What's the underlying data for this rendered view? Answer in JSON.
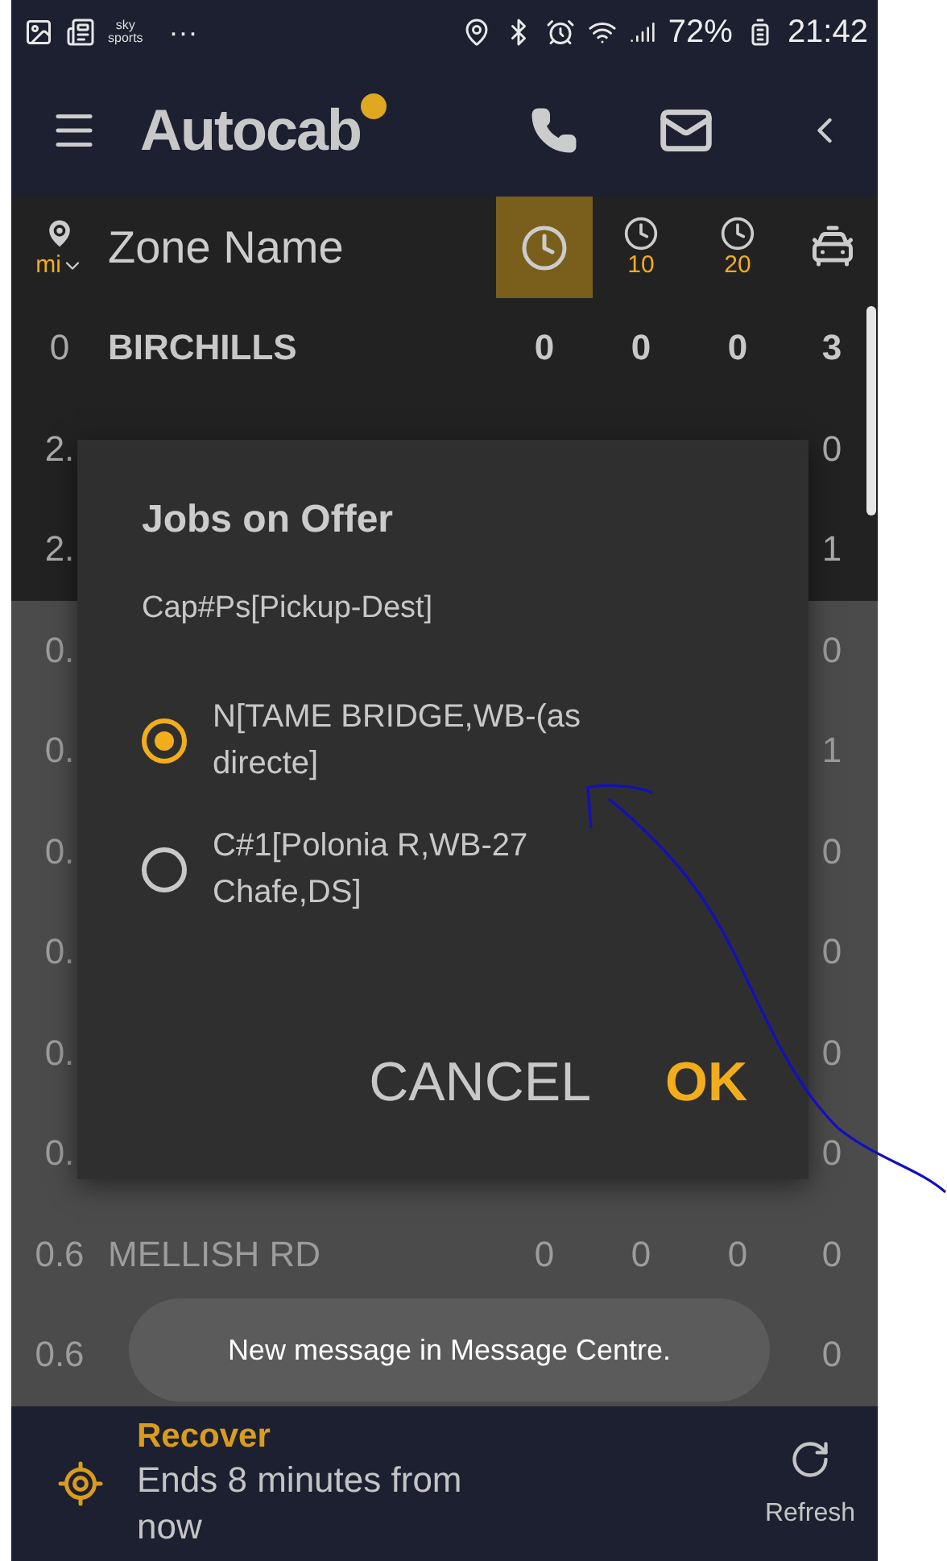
{
  "status_bar": {
    "notification_icons": [
      "sky",
      "sports",
      "···"
    ],
    "battery": "72%",
    "time": "21:42"
  },
  "app_bar": {
    "logo": "Autocab"
  },
  "header": {
    "unit": "mi",
    "zone_column": "Zone Name",
    "time_filters": [
      {
        "selected": true
      },
      {
        "label": "10",
        "selected": false
      },
      {
        "label": "20",
        "selected": false
      }
    ]
  },
  "rows": [
    {
      "distance": "0",
      "name": "BIRCHILLS",
      "counts": [
        "0",
        "0",
        "0"
      ],
      "cars": "3",
      "current": true,
      "dimmed": false
    },
    {
      "distance": "2.",
      "cars": "0",
      "current": false,
      "dimmed": false
    },
    {
      "distance": "2.",
      "cars": "1",
      "current": false,
      "dimmed": false
    },
    {
      "distance": "0.",
      "cars": "0",
      "current": false,
      "dimmed": true
    },
    {
      "distance": "0.",
      "cars": "1",
      "current": false,
      "dimmed": true
    },
    {
      "distance": "0.",
      "cars": "0",
      "current": false,
      "dimmed": true
    },
    {
      "distance": "0.",
      "cars": "0",
      "current": false,
      "dimmed": true
    },
    {
      "distance": "0.",
      "cars": "0",
      "current": false,
      "dimmed": true
    },
    {
      "distance": "0.",
      "cars": "0",
      "current": false,
      "dimmed": true
    },
    {
      "distance": "0.6",
      "name": "MELLISH RD",
      "counts": [
        "0",
        "0",
        "0"
      ],
      "cars": "0",
      "current": false,
      "dimmed": true
    },
    {
      "distance": "0.6",
      "cars": "0",
      "current": false,
      "dimmed": true
    }
  ],
  "dialog": {
    "title": "Jobs on Offer",
    "subtitle": "Cap#Ps[Pickup-Dest]",
    "options": [
      {
        "label": "N[TAME BRIDGE,WB-(as directe]",
        "selected": true
      },
      {
        "label": "C#1[Polonia R,WB-27 Chafe,DS]",
        "selected": false
      }
    ],
    "buttons": [
      {
        "label": "CANCEL",
        "kind": "secondary"
      },
      {
        "label": "OK",
        "kind": "primary"
      }
    ]
  },
  "toast": "New message in Message Centre.",
  "bottom_bar": {
    "title": "Recover",
    "text": "Ends 8 minutes from now",
    "action": "Refresh"
  }
}
